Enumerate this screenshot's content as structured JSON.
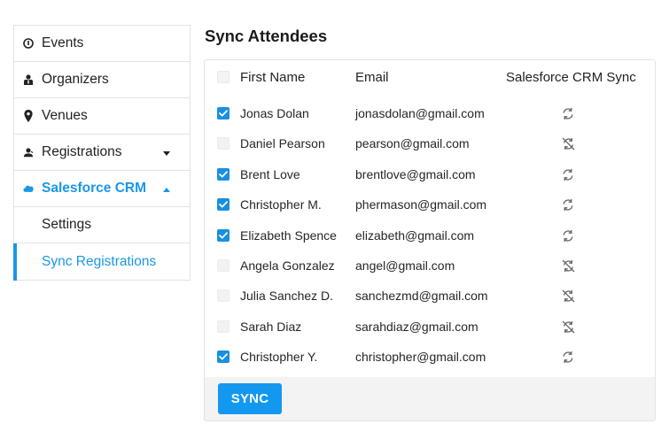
{
  "sidebar": {
    "items": [
      {
        "label": "Events",
        "icon": "info-circle-icon"
      },
      {
        "label": "Organizers",
        "icon": "organizer-person-icon"
      },
      {
        "label": "Venues",
        "icon": "map-pin-icon"
      },
      {
        "label": "Registrations",
        "icon": "user-group-icon"
      },
      {
        "label": "Salesforce CRM",
        "icon": "salesforce-cloud-icon"
      }
    ],
    "subitems": [
      {
        "label": "Settings"
      },
      {
        "label": "Sync Registrations"
      }
    ]
  },
  "page": {
    "title": "Sync Attendees"
  },
  "table": {
    "columns": [
      "First Name",
      "Email",
      "Salesforce CRM Sync"
    ],
    "rows": [
      {
        "name": "Jonas Dolan",
        "email": "jonasdolan@gmail.com",
        "checked": true,
        "sync": "sync-icon"
      },
      {
        "name": "Daniel Pearson",
        "email": "pearson@gmail.com",
        "checked": false,
        "sync": "sync-disabled-icon"
      },
      {
        "name": "Brent Love",
        "email": "brentlove@gmail.com",
        "checked": true,
        "sync": "sync-icon"
      },
      {
        "name": "Christopher M.",
        "email": "phermason@gmail.com",
        "checked": true,
        "sync": "sync-icon"
      },
      {
        "name": "Elizabeth Spence",
        "email": "elizabeth@gmail.com",
        "checked": true,
        "sync": "sync-icon"
      },
      {
        "name": "Angela Gonzalez",
        "email": "angel@gmail.com",
        "checked": false,
        "sync": "sync-disabled-icon"
      },
      {
        "name": "Julia Sanchez D.",
        "email": "sanchezmd@gmail.com",
        "checked": false,
        "sync": "sync-disabled-icon"
      },
      {
        "name": "Sarah Diaz",
        "email": "sarahdiaz@gmail.com",
        "checked": false,
        "sync": "sync-disabled-icon"
      },
      {
        "name": "Christopher Y.",
        "email": "christopher@gmail.com",
        "checked": true,
        "sync": "sync-icon"
      }
    ]
  },
  "actions": {
    "sync_label": "SYNC"
  },
  "colors": {
    "accent": "#1a97e6",
    "button": "#1398ef",
    "checkbox": "#1a8fe0"
  }
}
